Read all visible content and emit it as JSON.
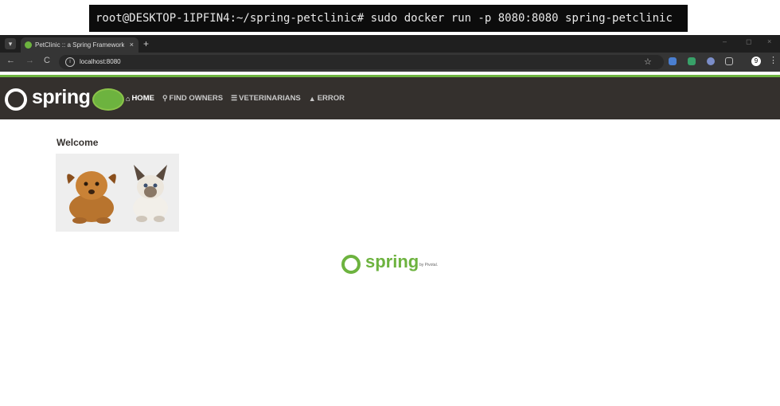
{
  "terminal": {
    "command_line": "root@DESKTOP-1IPFIN4:~/spring-petclinic# sudo docker run -p 8080:8080 spring-petclinic"
  },
  "browser": {
    "tab": {
      "title": "PetClinic :: a Spring Framework"
    },
    "tab_close": "×",
    "new_tab": "+",
    "window_controls": {
      "minimize": "–",
      "maximize": "◻",
      "close": "×"
    },
    "nav": {
      "back": "←",
      "forward": "→",
      "reload": "C"
    },
    "url": "localhost:8080",
    "profile_badge": "9",
    "extensions": [
      "puzzle-icon",
      "extension-green-icon",
      "extension-shield-icon"
    ]
  },
  "site": {
    "brand": "spring",
    "nav": [
      {
        "label": "HOME",
        "icon": "home-icon",
        "active": true
      },
      {
        "label": "FIND OWNERS",
        "icon": "search-icon",
        "active": false
      },
      {
        "label": "VETERINARIANS",
        "icon": "list-icon",
        "active": false
      },
      {
        "label": "ERROR",
        "icon": "warning-icon",
        "active": false
      }
    ],
    "welcome": "Welcome",
    "footer_brand": "spring",
    "footer_byline": "by Pivotal."
  },
  "colors": {
    "spring_green": "#6db33f",
    "navbar_bg": "#34302d",
    "terminal_bg": "#0c0c0c",
    "chrome_bg": "#1f1f1f"
  }
}
